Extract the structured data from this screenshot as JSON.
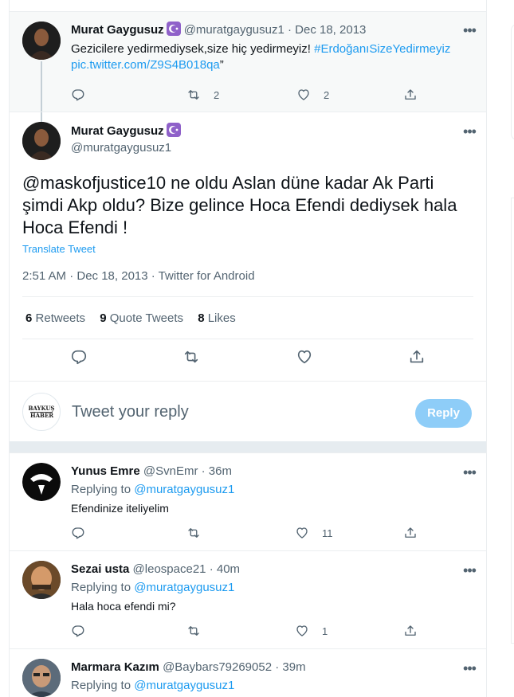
{
  "parent_tweet": {
    "name": "Murat Gaygusuz",
    "handle": "@muratgaygusuz1",
    "date": "· Dec 18, 2013",
    "text": "Gezicilere yedirmediysek,size hiç yedirmeyiz!",
    "hashtag": "#ErdoğanıSizeYedirmeyiz",
    "pic_link": "pic.twitter.com/Z9S4B018qa",
    "closing_quote": "”",
    "retweet_count": "2",
    "like_count": "2"
  },
  "main_tweet": {
    "name": "Murat Gaygusuz",
    "handle": "@muratgaygusuz1",
    "text": "@maskofjustice10 ne oldu Aslan düne kadar Ak Parti şimdi Akp oldu?  Bize gelince Hoca Efendi dediysek hala Hoca Efendi !",
    "translate_label": "Translate Tweet",
    "meta": "2:51 AM · Dec 18, 2013 · Twitter for Android",
    "stats": {
      "retweets_count": "6",
      "retweets_label": "Retweets",
      "quotes_count": "9",
      "quotes_label": "Quote Tweets",
      "likes_count": "8",
      "likes_label": "Likes"
    }
  },
  "compose": {
    "avatar_line1": "BAYKUŞ",
    "avatar_line2": "HABER",
    "placeholder": "Tweet your reply",
    "reply_button": "Reply"
  },
  "replies": [
    {
      "name": "Yunus Emre",
      "handle": "@SvnEmr",
      "time": "· 36m",
      "replying_label": "Replying to",
      "replying_to": "@muratgaygusuz1",
      "text": "Efendinize iteliyelim",
      "like_count": "11"
    },
    {
      "name": "Sezai usta",
      "handle": "@leospace21",
      "time": "· 40m",
      "replying_label": "Replying to",
      "replying_to": "@muratgaygusuz1",
      "text": "Hala hoca efendi mi?",
      "like_count": "1"
    },
    {
      "name": "Marmara Kazım",
      "handle": "@Baybars79269052",
      "time": "· 39m",
      "replying_label": "Replying to",
      "replying_to": "@muratgaygusuz1"
    }
  ],
  "colors": {
    "accent": "#1d9bf0",
    "badge": "#8f61c9",
    "reply_button": "#8ecdf8",
    "muted_text": "#536471"
  },
  "icons": [
    "reply-icon",
    "retweet-icon",
    "like-icon",
    "share-icon",
    "more-icon",
    "crescent-star-badge-icon"
  ]
}
